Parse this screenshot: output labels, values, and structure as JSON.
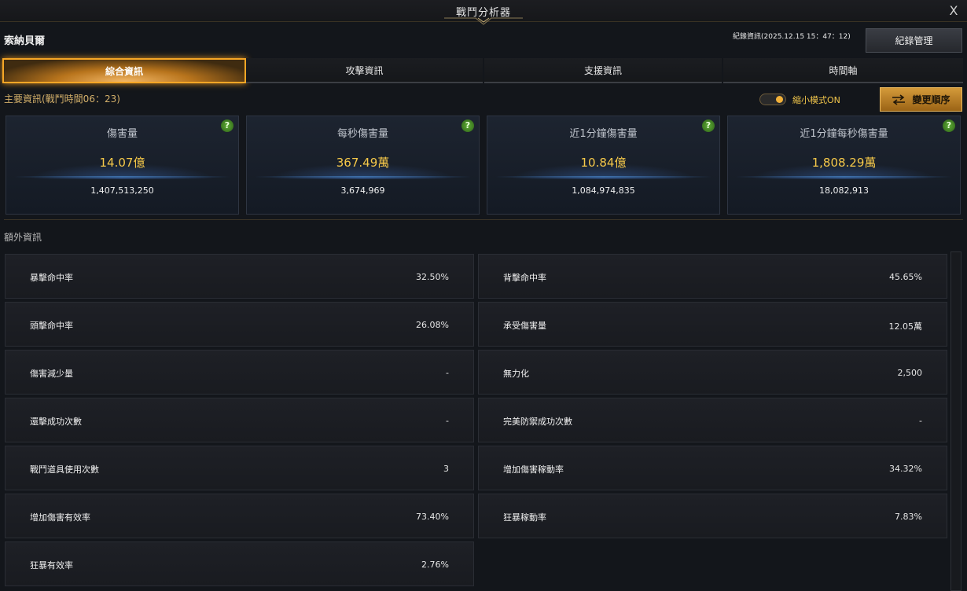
{
  "window": {
    "title": "戰鬥分析器",
    "close_label": "X"
  },
  "player": {
    "name": "索納貝爾"
  },
  "record": {
    "info": "紀錄資訊(2025.12.15 15：47：12)",
    "manage_label": "紀錄管理"
  },
  "tabs": [
    {
      "label": "綜合資訊",
      "active": true
    },
    {
      "label": "攻擊資訊",
      "active": false
    },
    {
      "label": "支援資訊",
      "active": false
    },
    {
      "label": "時間軸",
      "active": false
    }
  ],
  "main": {
    "label": "主要資訊(戰鬥時間06：23)",
    "compact_mode_label": "縮小模式ON",
    "compact_mode_on": true,
    "order_label": "變更順序",
    "cards": [
      {
        "title": "傷害量",
        "value": "14.07億",
        "raw": "1,407,513,250",
        "help": "?"
      },
      {
        "title": "每秒傷害量",
        "value": "367.49萬",
        "raw": "3,674,969",
        "help": "?"
      },
      {
        "title": "近1分鐘傷害量",
        "value": "10.84億",
        "raw": "1,084,974,835",
        "help": "?"
      },
      {
        "title": "近1分鐘每秒傷害量",
        "value": "1,808.29萬",
        "raw": "18,082,913",
        "help": "?"
      }
    ]
  },
  "extra": {
    "label": "額外資訊",
    "left": [
      {
        "label": "暴擊命中率",
        "value": "32.50%"
      },
      {
        "label": "頭擊命中率",
        "value": "26.08%"
      },
      {
        "label": "傷害減少量",
        "value": "-"
      },
      {
        "label": "還擊成功次數",
        "value": "-"
      },
      {
        "label": "戰鬥道具使用次數",
        "value": "3"
      },
      {
        "label": "增加傷害有效率",
        "value": "73.40%"
      },
      {
        "label": "狂暴有效率",
        "value": "2.76%"
      }
    ],
    "right": [
      {
        "label": "背擊命中率",
        "value": "45.65%"
      },
      {
        "label": "承受傷害量",
        "value": "12.05萬"
      },
      {
        "label": "無力化",
        "value": "2,500"
      },
      {
        "label": "完美防禦成功次數",
        "value": "-"
      },
      {
        "label": "增加傷害稼動率",
        "value": "34.32%"
      },
      {
        "label": "狂暴稼動率",
        "value": "7.83%"
      }
    ]
  },
  "colors": {
    "accent_gold": "#f6c94a",
    "tab_active_border": "#f5a626",
    "help_green": "#5fae36"
  }
}
